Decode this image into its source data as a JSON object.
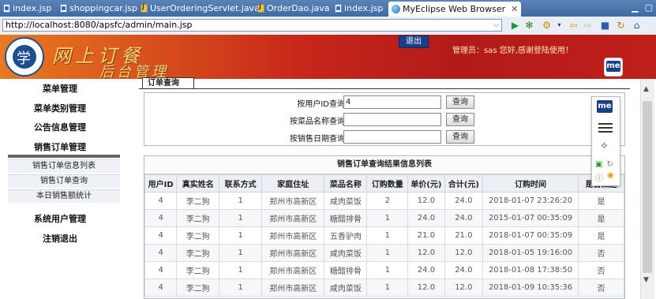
{
  "ide_tabs": [
    {
      "label": "index.jsp",
      "icon": "jsp-file-icon"
    },
    {
      "label": "shoppingcar.jsp",
      "icon": "jsp-file-icon"
    },
    {
      "label": "UserOrderingServlet.java",
      "icon": "java-file-icon"
    },
    {
      "label": "OrderDao.java",
      "icon": "java-file-icon"
    },
    {
      "label": "index.jsp",
      "icon": "jsp-file-icon"
    },
    {
      "label": "MyEclipse Web Browser",
      "icon": "globe-icon",
      "close": "✕"
    }
  ],
  "window_controls": {
    "minimize": "▁",
    "maximize": "▢"
  },
  "browser": {
    "url": "http://localhost:8080/apsfc/admin/main.jsp"
  },
  "header": {
    "title_main": "网上订餐",
    "title_sub": "后台管理",
    "logout_label": "退出",
    "welcome": "管理员：sas 您好,感谢登陆使用！",
    "badge": "me",
    "colors": {
      "start": "#e87a20",
      "end": "#b21a1a",
      "title": "#f2d27a"
    }
  },
  "sidebar": {
    "menus": [
      "菜单管理",
      "菜单类别管理",
      "公告信息管理",
      "销售订单管理"
    ],
    "submenus": [
      "销售订单信息列表",
      "销售订单查询",
      "本日销售额统计"
    ],
    "menus_after": [
      "系统用户管理",
      "注销退出"
    ]
  },
  "content": {
    "tab_label": "订单查询",
    "search": {
      "rows": [
        {
          "label": "按用户ID查询",
          "value": "4",
          "button": "查询"
        },
        {
          "label": "按菜品名称查询",
          "value": "",
          "button": "查询"
        },
        {
          "label": "按销售日期查询",
          "value": "",
          "button": "查询"
        }
      ]
    },
    "results": {
      "title": "销售订单查询结果信息列表",
      "columns": [
        "用户ID",
        "真实姓名",
        "联系方式",
        "家庭住址",
        "菜品名称",
        "订购数量",
        "单价(元)",
        "合计(元)",
        "订购时间",
        "是否派送"
      ],
      "rows": [
        [
          "4",
          "李二狗",
          "1",
          "郑州市高新区",
          "咸肉菜饭",
          "2",
          "12.0",
          "24.0",
          "2018-01-07 23:26:20",
          "是"
        ],
        [
          "4",
          "李二狗",
          "1",
          "郑州市高新区",
          "糖醋排骨",
          "1",
          "24.0",
          "24.0",
          "2015-01-07 00:35:09",
          "是"
        ],
        [
          "4",
          "李二狗",
          "1",
          "郑州市高新区",
          "五香驴肉",
          "1",
          "21.0",
          "21.0",
          "2018-01-07 00:35:09",
          "是"
        ],
        [
          "4",
          "李二狗",
          "1",
          "郑州市高新区",
          "咸肉菜饭",
          "1",
          "12.0",
          "12.0",
          "2018-01-05 19:16:00",
          "否"
        ],
        [
          "4",
          "李二狗",
          "1",
          "郑州市高新区",
          "糖醋排骨",
          "1",
          "24.0",
          "24.0",
          "2018-01-08 17:38:50",
          "否"
        ],
        [
          "4",
          "李二狗",
          "1",
          "郑州市高新区",
          "咸肉菜饭",
          "1",
          "12.0",
          "12.0",
          "2018-01-09 10:35:36",
          "否"
        ]
      ]
    }
  },
  "float_panel": {
    "badge": "me"
  }
}
